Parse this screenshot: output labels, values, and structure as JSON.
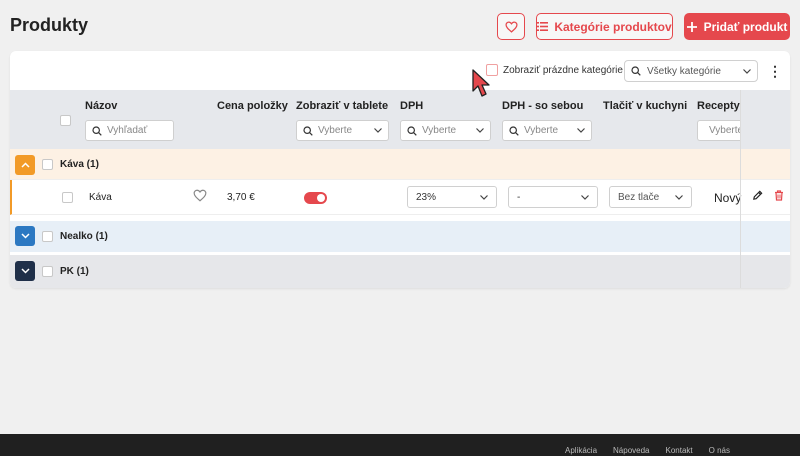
{
  "page": {
    "title": "Produkty"
  },
  "header": {
    "favorites_icon": "heart-icon",
    "categories_label": "Kategórie produktov",
    "add_label": "Pridať produkt"
  },
  "toolbar": {
    "show_empty_label": "Zobraziť prázdne kategórie",
    "category_filter_placeholder": "Všetky kategórie"
  },
  "table": {
    "columns": [
      {
        "label": "Názov",
        "filter": "Vyhľadať"
      },
      {
        "label": "Cena položky",
        "filter": ""
      },
      {
        "label": "Zobraziť v tablete",
        "filter": "Vyberte"
      },
      {
        "label": "DPH",
        "filter": "Vyberte"
      },
      {
        "label": "DPH - so sebou",
        "filter": "Vyberte"
      },
      {
        "label": "Tlačiť v kuchyni",
        "filter": ""
      },
      {
        "label": "Recepty",
        "filter": "Vyberte"
      }
    ],
    "categories": [
      {
        "name": "Káva (1)",
        "expanded": true,
        "color": "#f29a27",
        "products": [
          {
            "name": "Káva",
            "price": "3,70 €",
            "show_in_tablet": true,
            "vat": "23%",
            "vat_takeaway": "-",
            "kitchen_print": "Bez tlače",
            "recipe": "Nový"
          }
        ]
      },
      {
        "name": "Nealko (1)",
        "expanded": false,
        "color": "#2b78c2"
      },
      {
        "name": "PK (1)",
        "expanded": false,
        "color": "#1f2f49"
      }
    ]
  },
  "footer": {
    "links": [
      "Aplikácia",
      "Nápoveda",
      "Kontakt",
      "O nás"
    ]
  },
  "colors": {
    "accent": "#e5484d",
    "kava": "#f29a27",
    "nealko": "#2b78c2",
    "pk": "#1f2f49"
  }
}
